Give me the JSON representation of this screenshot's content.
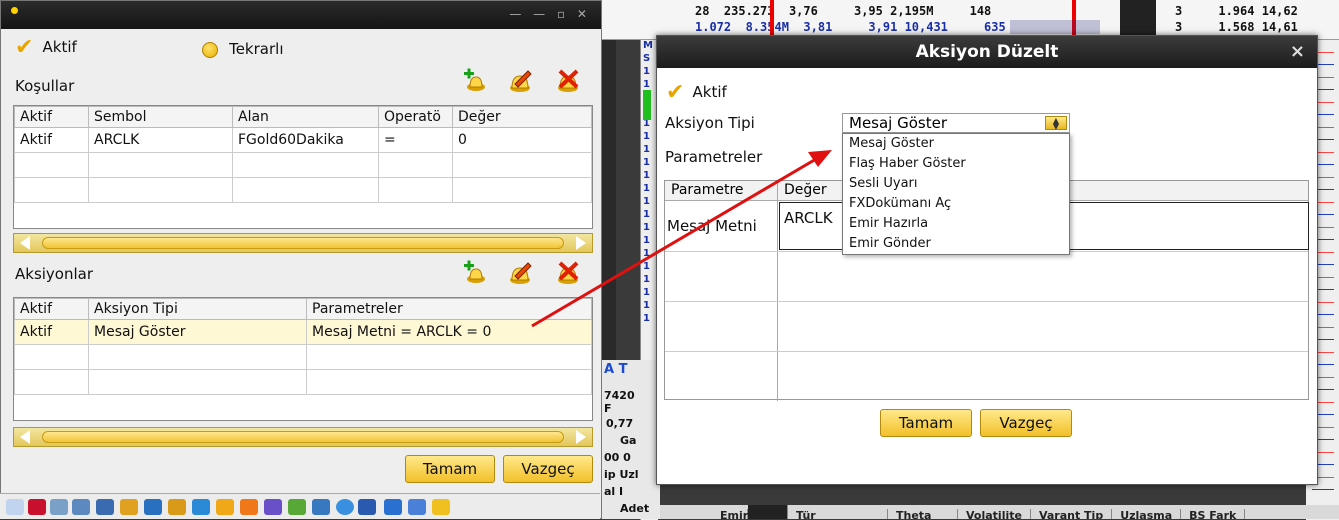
{
  "background": {
    "top_rows": [
      [
        "28",
        "235.273",
        "3,76",
        "3,95",
        "2,195M",
        "148",
        "3",
        "1.964",
        "14,62"
      ],
      [
        "1.072",
        "8.354M",
        "3,81",
        "3,91",
        "10,431",
        "635",
        "3",
        "1.568",
        "14,61"
      ]
    ],
    "side_letters": [
      "M",
      "S",
      "1",
      "1",
      "1",
      "1",
      "1",
      "1",
      "1",
      "1",
      "1",
      "1",
      "1",
      "1",
      "1",
      "1",
      "1",
      "1",
      "1",
      "1",
      "1",
      "1"
    ],
    "bottom_labels": [
      "A T",
      "7420",
      "F",
      "0,77",
      "Ga",
      "00 0",
      "ip Uzl",
      "al I",
      "Adet"
    ],
    "footer": [
      "Emir",
      "Tür",
      "Theta",
      "Volatilite",
      "Varant Tip",
      "Uzlaşma",
      "BS Fark"
    ]
  },
  "left_window": {
    "aktif_label": "Aktif",
    "tekrarli_label": "Tekrarlı",
    "kosullar_label": "Koşullar",
    "kosullar_columns": [
      "Aktif",
      "Sembol",
      "Alan",
      "Operatö",
      "Değer"
    ],
    "kosullar_rows": [
      [
        "Aktif",
        "ARCLK",
        "FGold60Dakika",
        "=",
        "0"
      ]
    ],
    "aksiyonlar_label": "Aksiyonlar",
    "aksiyonlar_columns": [
      "Aktif",
      "Aksiyon Tipi",
      "Parametreler"
    ],
    "aksiyonlar_rows": [
      [
        "Aktif",
        "Mesaj Göster",
        "Mesaj Metni = ARCLK = 0"
      ]
    ],
    "ok_label": "Tamam",
    "cancel_label": "Vazgeç"
  },
  "dialog": {
    "title": "Aksiyon Düzelt",
    "close": "×",
    "aktif_label": "Aktif",
    "aksiyon_tipi_label": "Aksiyon Tipi",
    "aksiyon_tipi_value": "Mesaj Göster",
    "options": [
      "Mesaj Göster",
      "Flaş Haber Göster",
      "Sesli Uyarı",
      "FXDokümanı Aç",
      "Emir Hazırla",
      "Emir Gönder"
    ],
    "parametreler_label": "Parametreler",
    "param_columns": [
      "Parametre",
      "Değer"
    ],
    "param_name": "Mesaj Metni",
    "param_value": "ARCLK",
    "ok_label": "Tamam",
    "cancel_label": "Vazgeç"
  },
  "colors": {
    "accent": "#f2c02a",
    "arrow": "#e01010",
    "title_bar": "#1c1c1c"
  }
}
